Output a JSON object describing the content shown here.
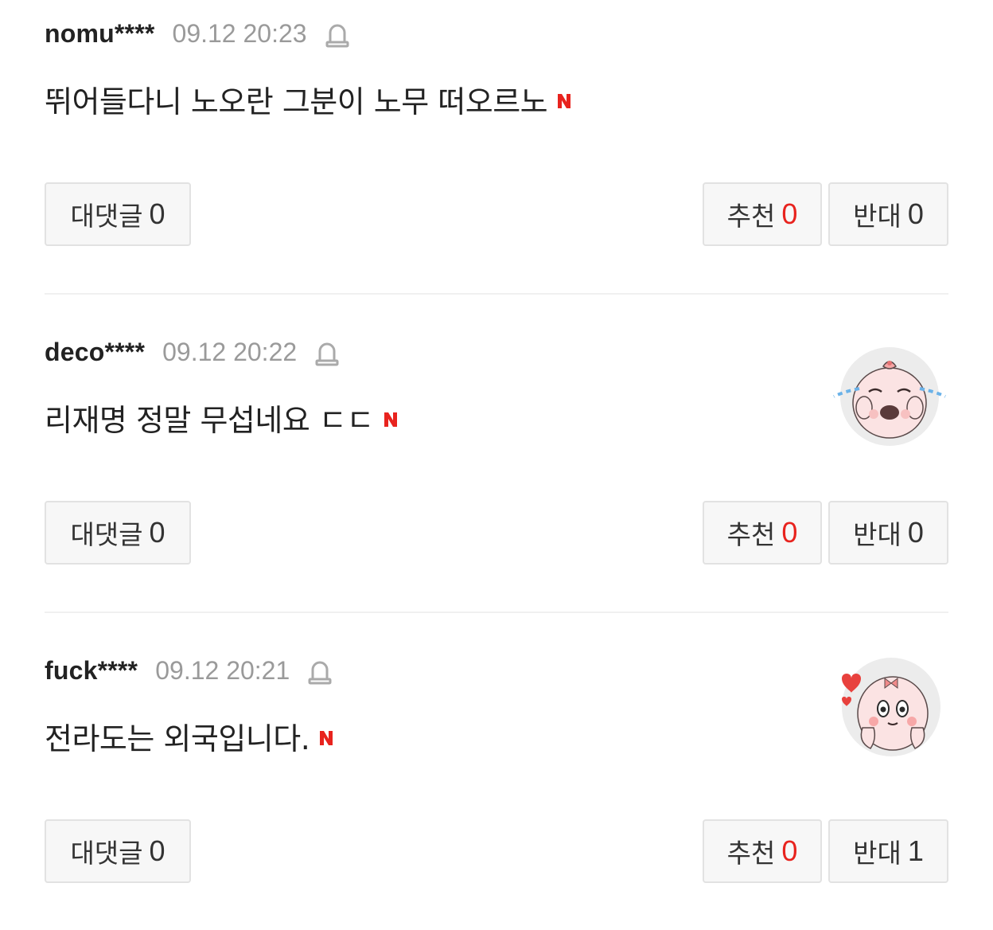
{
  "comments": [
    {
      "username": "nomu****",
      "timestamp": "09.12 20:23",
      "text": "뛰어들다니 노오란 그분이 노무 떠오르노",
      "new_badge": "N",
      "has_sticker": false,
      "reply_label": "대댓글",
      "reply_count": "0",
      "like_label": "추천",
      "like_count": "0",
      "dislike_label": "반대",
      "dislike_count": "0"
    },
    {
      "username": "deco****",
      "timestamp": "09.12 20:22",
      "text": "리재명 정말 무섭네요 ㄷㄷ",
      "new_badge": "N",
      "has_sticker": true,
      "sticker_icon": "crying-baby-sticker-icon",
      "reply_label": "대댓글",
      "reply_count": "0",
      "like_label": "추천",
      "like_count": "0",
      "dislike_label": "반대",
      "dislike_count": "0"
    },
    {
      "username": "fuck****",
      "timestamp": "09.12 20:21",
      "text": "전라도는 외국입니다.",
      "new_badge": "N",
      "has_sticker": true,
      "sticker_icon": "heart-baby-sticker-icon",
      "reply_label": "대댓글",
      "reply_count": "0",
      "like_label": "추천",
      "like_count": "0",
      "dislike_label": "반대",
      "dislike_count": "1"
    }
  ],
  "icons": {
    "report": "siren-report-icon",
    "new": "new-badge-icon"
  },
  "colors": {
    "like_count": "#e8231e",
    "new_badge": "#e8231e",
    "timestamp": "#9a9a9a",
    "button_bg": "#f7f7f7",
    "button_border": "#e2e2e2"
  }
}
